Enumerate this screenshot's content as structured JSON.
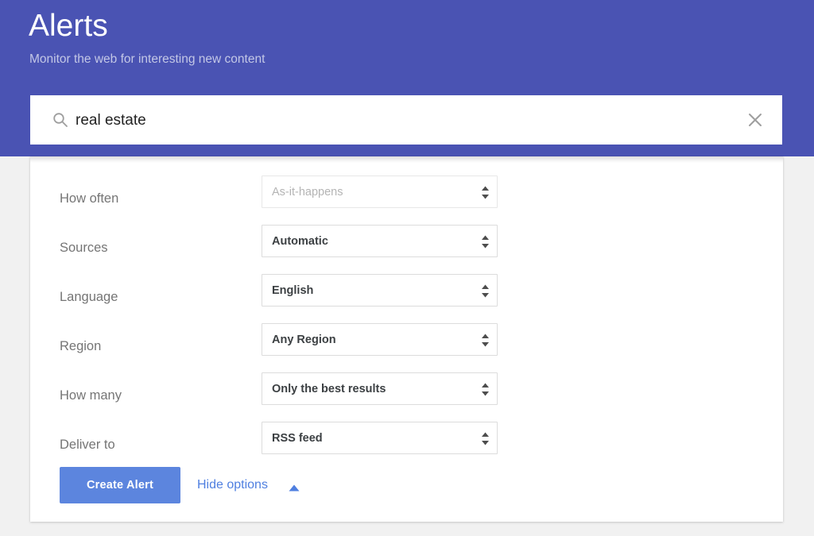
{
  "header": {
    "title": "Alerts",
    "subtitle": "Monitor the web for interesting new content",
    "background_color": "#4a53b3",
    "title_color": "#ffffff",
    "subtitle_color": "#c3c7e6"
  },
  "search": {
    "icon": "search-icon",
    "value": "real estate",
    "placeholder": "",
    "clear_icon": "close-icon"
  },
  "options": [
    {
      "label": "How often",
      "value": "As-it-happens",
      "disabled": true,
      "icon": "spinner-arrows-icon"
    },
    {
      "label": "Sources",
      "value": "Automatic",
      "disabled": false,
      "icon": "spinner-arrows-icon"
    },
    {
      "label": "Language",
      "value": "English",
      "disabled": false,
      "icon": "spinner-arrows-icon"
    },
    {
      "label": "Region",
      "value": "Any Region",
      "disabled": false,
      "icon": "spinner-arrows-icon"
    },
    {
      "label": "How many",
      "value": "Only the best results",
      "disabled": false,
      "icon": "spinner-arrows-icon"
    },
    {
      "label": "Deliver to",
      "value": "RSS feed",
      "disabled": false,
      "icon": "spinner-arrows-icon"
    }
  ],
  "actions": {
    "create_label": "Create Alert",
    "create_color": "#5c85de",
    "hide_options_label": "Hide options",
    "hide_options_color": "#4f7fe0",
    "hide_options_icon": "caret-up-icon"
  },
  "page": {
    "background_color": "#f1f1f1",
    "card_color": "#ffffff"
  }
}
